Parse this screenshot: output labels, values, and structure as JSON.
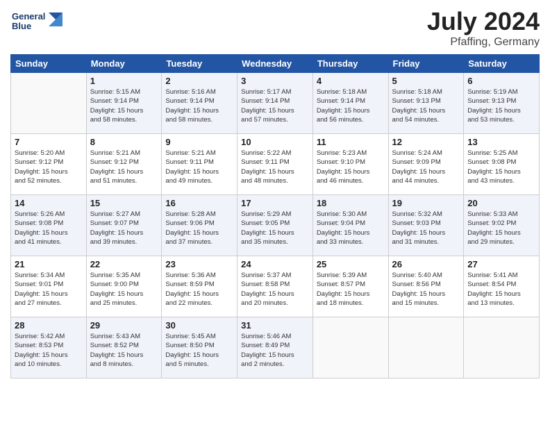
{
  "header": {
    "logo_line1": "General",
    "logo_line2": "Blue",
    "month_year": "July 2024",
    "location": "Pfaffing, Germany"
  },
  "weekdays": [
    "Sunday",
    "Monday",
    "Tuesday",
    "Wednesday",
    "Thursday",
    "Friday",
    "Saturday"
  ],
  "weeks": [
    [
      {
        "day": "",
        "info": ""
      },
      {
        "day": "1",
        "info": "Sunrise: 5:15 AM\nSunset: 9:14 PM\nDaylight: 15 hours\nand 58 minutes."
      },
      {
        "day": "2",
        "info": "Sunrise: 5:16 AM\nSunset: 9:14 PM\nDaylight: 15 hours\nand 58 minutes."
      },
      {
        "day": "3",
        "info": "Sunrise: 5:17 AM\nSunset: 9:14 PM\nDaylight: 15 hours\nand 57 minutes."
      },
      {
        "day": "4",
        "info": "Sunrise: 5:18 AM\nSunset: 9:14 PM\nDaylight: 15 hours\nand 56 minutes."
      },
      {
        "day": "5",
        "info": "Sunrise: 5:18 AM\nSunset: 9:13 PM\nDaylight: 15 hours\nand 54 minutes."
      },
      {
        "day": "6",
        "info": "Sunrise: 5:19 AM\nSunset: 9:13 PM\nDaylight: 15 hours\nand 53 minutes."
      }
    ],
    [
      {
        "day": "7",
        "info": "Sunrise: 5:20 AM\nSunset: 9:12 PM\nDaylight: 15 hours\nand 52 minutes."
      },
      {
        "day": "8",
        "info": "Sunrise: 5:21 AM\nSunset: 9:12 PM\nDaylight: 15 hours\nand 51 minutes."
      },
      {
        "day": "9",
        "info": "Sunrise: 5:21 AM\nSunset: 9:11 PM\nDaylight: 15 hours\nand 49 minutes."
      },
      {
        "day": "10",
        "info": "Sunrise: 5:22 AM\nSunset: 9:11 PM\nDaylight: 15 hours\nand 48 minutes."
      },
      {
        "day": "11",
        "info": "Sunrise: 5:23 AM\nSunset: 9:10 PM\nDaylight: 15 hours\nand 46 minutes."
      },
      {
        "day": "12",
        "info": "Sunrise: 5:24 AM\nSunset: 9:09 PM\nDaylight: 15 hours\nand 44 minutes."
      },
      {
        "day": "13",
        "info": "Sunrise: 5:25 AM\nSunset: 9:08 PM\nDaylight: 15 hours\nand 43 minutes."
      }
    ],
    [
      {
        "day": "14",
        "info": "Sunrise: 5:26 AM\nSunset: 9:08 PM\nDaylight: 15 hours\nand 41 minutes."
      },
      {
        "day": "15",
        "info": "Sunrise: 5:27 AM\nSunset: 9:07 PM\nDaylight: 15 hours\nand 39 minutes."
      },
      {
        "day": "16",
        "info": "Sunrise: 5:28 AM\nSunset: 9:06 PM\nDaylight: 15 hours\nand 37 minutes."
      },
      {
        "day": "17",
        "info": "Sunrise: 5:29 AM\nSunset: 9:05 PM\nDaylight: 15 hours\nand 35 minutes."
      },
      {
        "day": "18",
        "info": "Sunrise: 5:30 AM\nSunset: 9:04 PM\nDaylight: 15 hours\nand 33 minutes."
      },
      {
        "day": "19",
        "info": "Sunrise: 5:32 AM\nSunset: 9:03 PM\nDaylight: 15 hours\nand 31 minutes."
      },
      {
        "day": "20",
        "info": "Sunrise: 5:33 AM\nSunset: 9:02 PM\nDaylight: 15 hours\nand 29 minutes."
      }
    ],
    [
      {
        "day": "21",
        "info": "Sunrise: 5:34 AM\nSunset: 9:01 PM\nDaylight: 15 hours\nand 27 minutes."
      },
      {
        "day": "22",
        "info": "Sunrise: 5:35 AM\nSunset: 9:00 PM\nDaylight: 15 hours\nand 25 minutes."
      },
      {
        "day": "23",
        "info": "Sunrise: 5:36 AM\nSunset: 8:59 PM\nDaylight: 15 hours\nand 22 minutes."
      },
      {
        "day": "24",
        "info": "Sunrise: 5:37 AM\nSunset: 8:58 PM\nDaylight: 15 hours\nand 20 minutes."
      },
      {
        "day": "25",
        "info": "Sunrise: 5:39 AM\nSunset: 8:57 PM\nDaylight: 15 hours\nand 18 minutes."
      },
      {
        "day": "26",
        "info": "Sunrise: 5:40 AM\nSunset: 8:56 PM\nDaylight: 15 hours\nand 15 minutes."
      },
      {
        "day": "27",
        "info": "Sunrise: 5:41 AM\nSunset: 8:54 PM\nDaylight: 15 hours\nand 13 minutes."
      }
    ],
    [
      {
        "day": "28",
        "info": "Sunrise: 5:42 AM\nSunset: 8:53 PM\nDaylight: 15 hours\nand 10 minutes."
      },
      {
        "day": "29",
        "info": "Sunrise: 5:43 AM\nSunset: 8:52 PM\nDaylight: 15 hours\nand 8 minutes."
      },
      {
        "day": "30",
        "info": "Sunrise: 5:45 AM\nSunset: 8:50 PM\nDaylight: 15 hours\nand 5 minutes."
      },
      {
        "day": "31",
        "info": "Sunrise: 5:46 AM\nSunset: 8:49 PM\nDaylight: 15 hours\nand 2 minutes."
      },
      {
        "day": "",
        "info": ""
      },
      {
        "day": "",
        "info": ""
      },
      {
        "day": "",
        "info": ""
      }
    ]
  ]
}
